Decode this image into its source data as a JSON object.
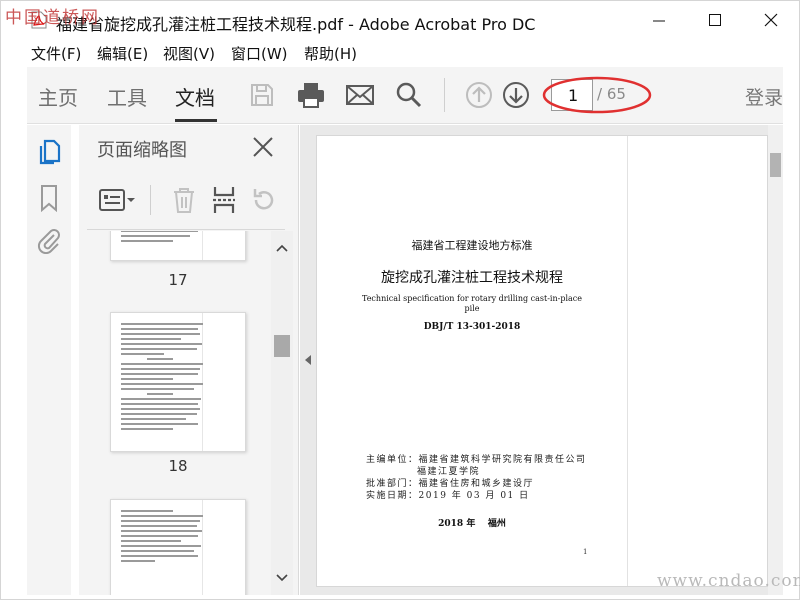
{
  "watermark_top": "中国道桥网",
  "watermark_bottom": "www.cndao.com",
  "window": {
    "title": "福建省旋挖成孔灌注桩工程技术规程.pdf - Adobe Acrobat Pro DC"
  },
  "menu": {
    "items": [
      {
        "label": "文件(F)"
      },
      {
        "label": "编辑(E)"
      },
      {
        "label": "视图(V)"
      },
      {
        "label": "窗口(W)"
      },
      {
        "label": "帮助(H)"
      }
    ]
  },
  "toolbar": {
    "tabs": [
      {
        "label": "主页"
      },
      {
        "label": "工具"
      },
      {
        "label": "文档"
      }
    ],
    "active_tab": "文档",
    "page_current": "1",
    "page_total": "/ 65",
    "login": "登录",
    "annotation_color": "#e03030",
    "icons": [
      "save-icon",
      "print-icon",
      "email-icon",
      "search-icon",
      "previous-page-icon",
      "next-page-icon"
    ]
  },
  "panel": {
    "title": "页面缩略图",
    "thumbnails": [
      {
        "label": "17"
      },
      {
        "label": "18"
      }
    ]
  },
  "document": {
    "header_small": "福建省工程建设地方标准",
    "title_cn": "旋挖成孔灌注桩工程技术规程",
    "title_en_line1": "Technical specification for rotary drilling cast-in-place",
    "title_en_line2": "pile",
    "code": "DBJ/T 13-301-2018",
    "info": [
      {
        "label": "主编单位：",
        "value": "福建省建筑科学研究院有限责任公司"
      },
      {
        "label": "",
        "value": "福建江夏学院"
      },
      {
        "label": "批准部门：",
        "value": "福建省住房和城乡建设厅"
      },
      {
        "label": "实施日期：",
        "value": "2019 年 03 月 01 日"
      }
    ],
    "footer": "2018 年    福州",
    "page_number": "1"
  }
}
